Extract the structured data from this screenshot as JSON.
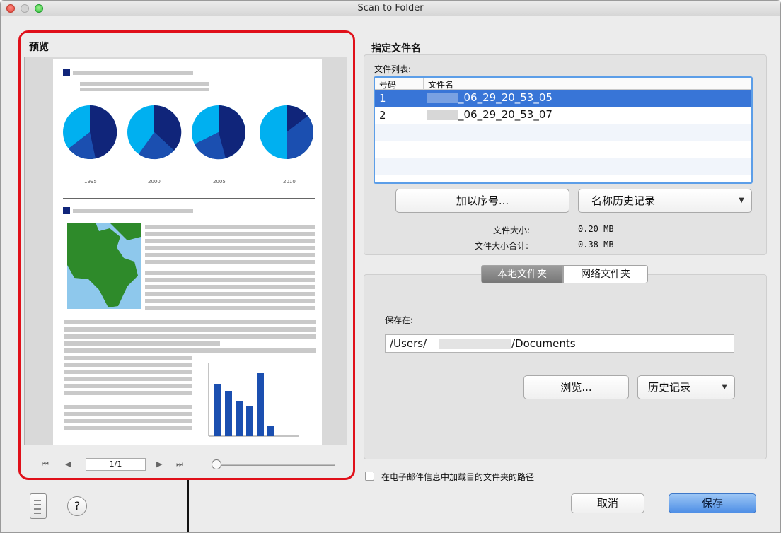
{
  "window": {
    "title": "Scan to Folder"
  },
  "preview": {
    "label": "预览",
    "page_indicator": "1/1",
    "zoom_level": 0.02,
    "doc_years": [
      "1995",
      "2000",
      "2005",
      "2010"
    ]
  },
  "filename_section": {
    "title": "指定文件名",
    "list_label": "文件列表:",
    "columns": [
      "号码",
      "文件名"
    ],
    "rows": [
      {
        "num": "1",
        "name": "_06_29_20_53_05",
        "selected": true
      },
      {
        "num": "2",
        "name": "_06_29_20_53_07",
        "selected": false
      }
    ],
    "add_number_button": "加以序号...",
    "name_history_button": "名称历史记录",
    "file_size_label": "文件大小:",
    "file_size_value": "0.20 MB",
    "total_size_label": "文件大小合计:",
    "total_size_value": "0.38 MB"
  },
  "folder_section": {
    "tabs": [
      "本地文件夹",
      "网络文件夹"
    ],
    "save_in_label": "保存在:",
    "path_prefix": "/Users/",
    "path_suffix": "/Documents",
    "browse_button": "浏览...",
    "history_button": "历史记录"
  },
  "footer": {
    "email_path_checkbox": "在电子邮件信息中加载目的文件夹的路径",
    "cancel_button": "取消",
    "save_button": "保存"
  },
  "colors": {
    "accent": "#3875d7",
    "highlight_frame": "#e0101a",
    "pie_dark": "#10257a",
    "pie_light": "#00b0f0"
  },
  "icons": [
    "close-icon",
    "minimize-icon",
    "zoom-icon",
    "first-page-icon",
    "prev-page-icon",
    "next-page-icon",
    "last-page-icon",
    "dropdown-arrow-icon",
    "document-list-icon",
    "help-icon"
  ]
}
